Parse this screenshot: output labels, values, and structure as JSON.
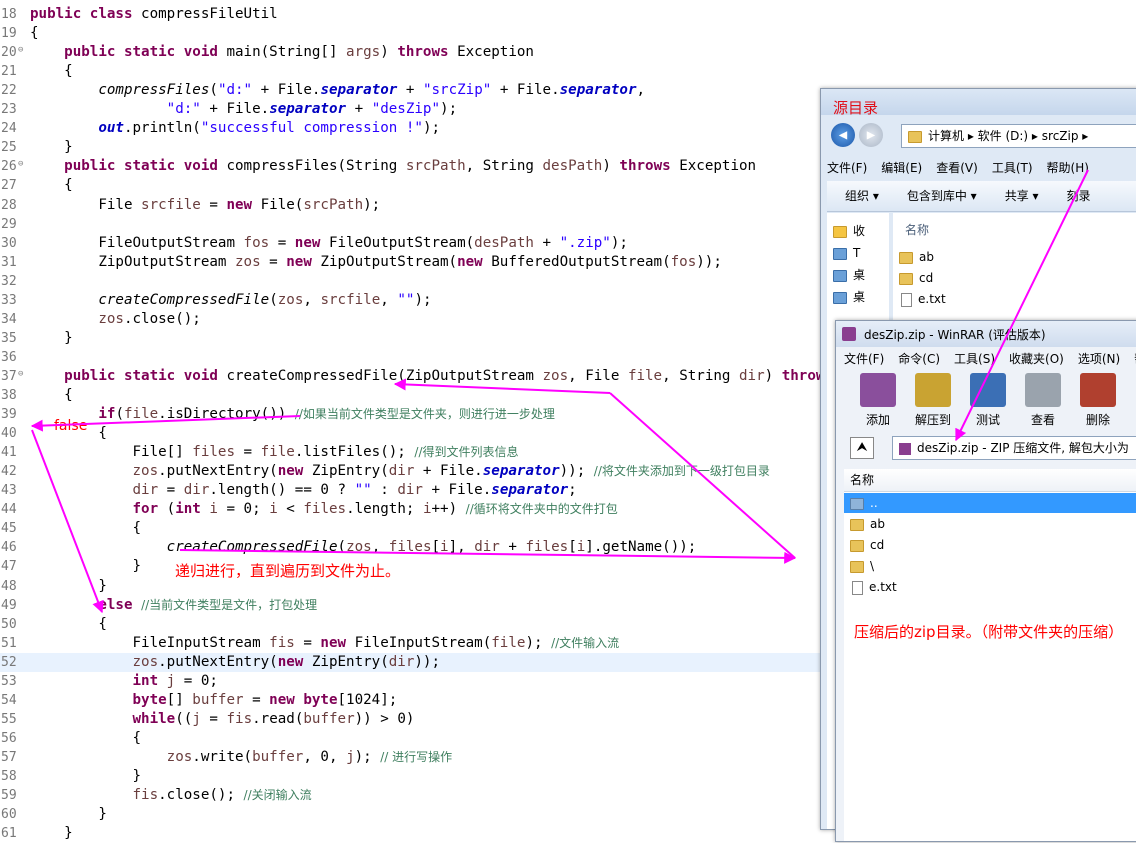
{
  "code": [
    {
      "n": "18",
      "h": "<span class=\"kw\">public class</span> compressFileUtil"
    },
    {
      "n": "19",
      "h": "{"
    },
    {
      "n": "20",
      "f": true,
      "h": "    <span class=\"kw\">public static void</span> main(String[] <span class=\"var\">args</span>) <span class=\"kw\">throws</span> Exception"
    },
    {
      "n": "21",
      "h": "    {"
    },
    {
      "n": "22",
      "h": "        <span class=\"it\">compressFiles</span>(<span class=\"str\">\"d:\"</span> + File.<span class=\"fld\">separator</span> + <span class=\"str\">\"srcZip\"</span> + File.<span class=\"fld\">separator</span>,"
    },
    {
      "n": "23",
      "h": "                <span class=\"str\">\"d:\"</span> + File.<span class=\"fld\">separator</span> + <span class=\"str\">\"desZip\"</span>);"
    },
    {
      "n": "24",
      "h": "        <span class=\"fld\">out</span>.println(<span class=\"str\">\"successful compression !\"</span>);"
    },
    {
      "n": "25",
      "h": "    }"
    },
    {
      "n": "26",
      "f": true,
      "h": "    <span class=\"kw\">public static void</span> compressFiles(String <span class=\"var\">srcPath</span>, String <span class=\"var\">desPath</span>) <span class=\"kw\">throws</span> Exception"
    },
    {
      "n": "27",
      "h": "    {"
    },
    {
      "n": "28",
      "h": "        File <span class=\"var\">srcfile</span> = <span class=\"kw\">new</span> File(<span class=\"var\">srcPath</span>);"
    },
    {
      "n": "29",
      "h": ""
    },
    {
      "n": "30",
      "h": "        FileOutputStream <span class=\"var\">fos</span> = <span class=\"kw\">new</span> FileOutputStream(<span class=\"var\">desPath</span> + <span class=\"str\">\".zip\"</span>);"
    },
    {
      "n": "31",
      "h": "        ZipOutputStream <span class=\"var\">zos</span> = <span class=\"kw\">new</span> ZipOutputStream(<span class=\"kw\">new</span> BufferedOutputStream(<span class=\"var\">fos</span>));"
    },
    {
      "n": "32",
      "h": ""
    },
    {
      "n": "33",
      "h": "        <span class=\"it\">createCompressedFile</span>(<span class=\"var\">zos</span>, <span class=\"var\">srcfile</span>, <span class=\"str\">\"\"</span>);"
    },
    {
      "n": "34",
      "h": "        <span class=\"var\">zos</span>.close();"
    },
    {
      "n": "35",
      "h": "    }"
    },
    {
      "n": "36",
      "h": ""
    },
    {
      "n": "37",
      "f": true,
      "h": "    <span class=\"kw\">public static void</span> createCompressedFile(ZipOutputStream <span class=\"var\">zos</span>, File <span class=\"var\">file</span>, String <span class=\"var\">dir</span>) <span class=\"kw\">throws</span> Exception"
    },
    {
      "n": "38",
      "h": "    {"
    },
    {
      "n": "39",
      "h": "        <span class=\"kw\">if</span>(<span class=\"var\">file</span>.isDirectory()) <span class=\"cmt\">//如果当前文件类型是文件夹，则进行进一步处理</span>"
    },
    {
      "n": "40",
      "h": "        {"
    },
    {
      "n": "41",
      "h": "            File[] <span class=\"var\">files</span> = <span class=\"var\">file</span>.listFiles(); <span class=\"cmt\">//得到文件列表信息</span>"
    },
    {
      "n": "42",
      "h": "            <span class=\"var\">zos</span>.putNextEntry(<span class=\"kw\">new</span> ZipEntry(<span class=\"var\">dir</span> + File.<span class=\"fld\">separator</span>)); <span class=\"cmt\">//将文件夹添加到下一级打包目录</span>"
    },
    {
      "n": "43",
      "h": "            <span class=\"var\">dir</span> = <span class=\"var\">dir</span>.length() == 0 ? <span class=\"str\">\"\"</span> : <span class=\"var\">dir</span> + File.<span class=\"fld\">separator</span>;"
    },
    {
      "n": "44",
      "h": "            <span class=\"kw\">for</span> (<span class=\"kw\">int</span> <span class=\"var\">i</span> = 0; <span class=\"var\">i</span> &lt; <span class=\"var\">files</span>.length; <span class=\"var\">i</span>++) <span class=\"cmt\">//循环将文件夹中的文件打包</span>"
    },
    {
      "n": "45",
      "h": "            {"
    },
    {
      "n": "46",
      "h": "                <span class=\"it\">createCompressedFile</span>(<span class=\"var\">zos</span>, <span class=\"var\">files</span>[<span class=\"var\">i</span>], <span class=\"var\">dir</span> + <span class=\"var\">files</span>[<span class=\"var\">i</span>].getName());"
    },
    {
      "n": "47",
      "h": "            }"
    },
    {
      "n": "48",
      "h": "        }"
    },
    {
      "n": "49",
      "h": "        <span class=\"kw\">else</span> <span class=\"cmt\">//当前文件类型是文件，打包处理</span>"
    },
    {
      "n": "50",
      "h": "        {"
    },
    {
      "n": "51",
      "h": "            FileInputStream <span class=\"var\">fis</span> = <span class=\"kw\">new</span> FileInputStream(<span class=\"var\">file</span>); <span class=\"cmt\">//文件输入流</span>"
    },
    {
      "n": "52",
      "hl": true,
      "h": "            <span class=\"var\">zos</span>.putNextEntry(<span class=\"kw\">new</span> ZipEntry(<span class=\"var\">dir</span>));"
    },
    {
      "n": "53",
      "h": "            <span class=\"kw\">int</span> <span class=\"var\">j</span> = 0;"
    },
    {
      "n": "54",
      "h": "            <span class=\"kw\">byte</span>[] <span class=\"var\">buffer</span> = <span class=\"kw\">new byte</span>[1024];"
    },
    {
      "n": "55",
      "h": "            <span class=\"kw\">while</span>((<span class=\"var\">j</span> = <span class=\"var\">fis</span>.read(<span class=\"var\">buffer</span>)) &gt; 0)"
    },
    {
      "n": "56",
      "h": "            {"
    },
    {
      "n": "57",
      "h": "                <span class=\"var\">zos</span>.write(<span class=\"var\">buffer</span>, 0, <span class=\"var\">j</span>); <span class=\"cmt\">// 进行写操作</span>"
    },
    {
      "n": "58",
      "h": "            }"
    },
    {
      "n": "59",
      "h": "            <span class=\"var\">fis</span>.close(); <span class=\"cmt\">//关闭输入流</span>"
    },
    {
      "n": "60",
      "h": "        }"
    },
    {
      "n": "61",
      "h": "    }"
    }
  ],
  "annotations": {
    "false_label": "false",
    "recursion_note": "递归进行，直到遍历到文件为止。",
    "zip_note": "压缩后的zip目录。（附带文件夹的压缩）"
  },
  "explorer": {
    "title": "源目录",
    "back": "◀",
    "forward": "▶",
    "address": "计算机  ▸  软件 (D:)  ▸  srcZip  ▸",
    "menu": [
      "文件(F)",
      "编辑(E)",
      "查看(V)",
      "工具(T)",
      "帮助(H)"
    ],
    "commands": [
      "组织 ▾",
      "包含到库中 ▾",
      "共享 ▾",
      "刻录"
    ],
    "nav": [
      "收",
      "T",
      "桌",
      "桌"
    ],
    "column": "名称",
    "files": [
      {
        "name": "ab",
        "type": "folder"
      },
      {
        "name": "cd",
        "type": "folder"
      },
      {
        "name": "e.txt",
        "type": "file"
      }
    ]
  },
  "winrar": {
    "title": "desZip.zip - WinRAR (评估版本)",
    "menu": [
      "文件(F)",
      "命令(C)",
      "工具(S)",
      "收藏夹(O)",
      "选项(N)",
      "帮"
    ],
    "tools": [
      {
        "label": "添加",
        "color": "#8a4f9c"
      },
      {
        "label": "解压到",
        "color": "#c9a332"
      },
      {
        "label": "测试",
        "color": "#3b6fb5"
      },
      {
        "label": "查看",
        "color": "#9aa3ad"
      },
      {
        "label": "删除",
        "color": "#b0402f"
      }
    ],
    "up_icon": "⮝",
    "path": "desZip.zip - ZIP 压缩文件, 解包大小为",
    "column": "名称",
    "entries": [
      {
        "name": "..",
        "type": "up"
      },
      {
        "name": "ab",
        "type": "folder"
      },
      {
        "name": "cd",
        "type": "folder"
      },
      {
        "name": "\\",
        "type": "folder"
      },
      {
        "name": "e.txt",
        "type": "file"
      }
    ]
  }
}
